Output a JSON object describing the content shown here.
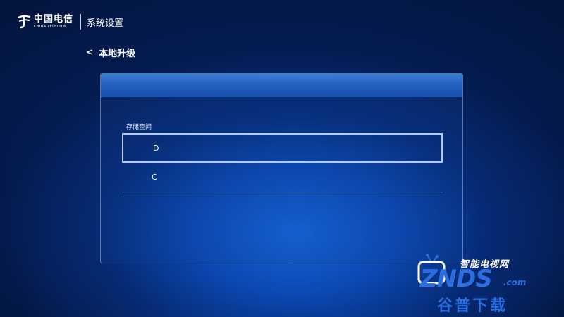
{
  "header": {
    "logo_cn": "中国电信",
    "logo_en": "CHINA TELECOM",
    "title": "系统设置"
  },
  "page": {
    "back_chevron": "<",
    "title": "本地升级"
  },
  "storage": {
    "section_label": "存储空间",
    "items": [
      {
        "label": "D",
        "selected": true
      },
      {
        "label": "C",
        "selected": false
      }
    ]
  },
  "watermark": {
    "top_text": "智能电视网",
    "brand": "ZNDS",
    "domain": ".com",
    "bottom_text": "谷普下载"
  },
  "colors": {
    "background": "#041845",
    "accent_glow": "#1565d8",
    "panel_header": "#2462c2",
    "watermark_blue": "#2b6ee0"
  },
  "icons": {
    "logo": "china-telecom-logo-icon",
    "back": "chevron-left-icon",
    "watermark_tv": "tv-icon"
  }
}
